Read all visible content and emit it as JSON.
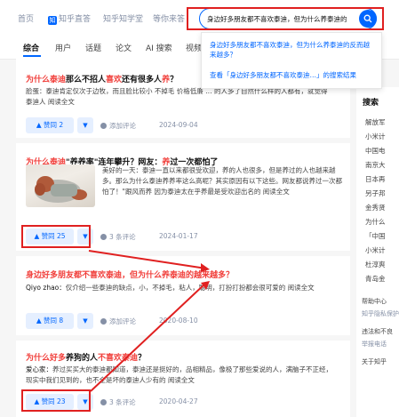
{
  "nav": {
    "home": "首页",
    "zhihu_direct": "知乎直答",
    "zhihu_learning": "知乎知学堂",
    "waiting": "等你来答"
  },
  "search": {
    "query": "身边好多朋友都不喜欢泰迪，但为什么养泰迪的",
    "suggestion_line": "身边好多朋友都不喜欢泰迪，但为什么养泰迪的反而越来越多？",
    "suggestion_search": "查看「身边好多朋友都不喜欢泰迪…」的搜索结果"
  },
  "tabs": [
    "综合",
    "用户",
    "话题",
    "论文",
    "AI 搜索",
    "视频"
  ],
  "results": [
    {
      "title_hl1": "为什么泰迪",
      "title_mid": "那么不招人",
      "title_hl2": "喜欢",
      "title_tail": "还有很多人",
      "title_hl3": "养",
      "title_end": "？",
      "excerpt": "脸蛋：泰迪肯定仅次于边牧，而且脸比较小 不掉毛 价格低廉 … 的人多了自然什么样的人都有，就觉得泰迪人 阅读全文",
      "vote": "▲ 赞同 2",
      "comment": "添加评论",
      "date": "2024-09-04"
    },
    {
      "title_hl1": "为什么泰迪",
      "title_mid": "\"养养率\"连年攀升？网友：",
      "title_hl2": "养",
      "title_tail": "过一次都怕了",
      "title_hl3": "",
      "title_end": "",
      "excerpt": "美好的一天：泰迪一直以来都很受欢迎，养的人也很多，但是养过的人也越来越多。那么为什么泰迪养养率这么高呢？其实原因有以下这些。网友都说养过一次都怕了！\"跟风而养 因为泰迪太在乎养最是受欢迎出名的 阅读全文",
      "vote": "▲ 赞同 25",
      "comment": "3 条评论",
      "date": "2024-01-17"
    },
    {
      "title_hl1": "身边好多朋友都不喜欢泰迪，但为什么养泰迪的越来越多？",
      "title_mid": "",
      "title_hl2": "",
      "title_tail": "",
      "title_hl3": "",
      "title_end": "",
      "excerpt_name": "Qiyo zhao：",
      "excerpt": "仅介绍一些泰迪的缺点，小，不掉毛，粘人，聪明，打扮打扮都会很可爱的 阅读全文",
      "vote": "▲ 赞同 8",
      "comment": "添加评论",
      "date": "2020-08-10"
    },
    {
      "title_hl1": "为什么好多",
      "title_mid": "养狗的人",
      "title_hl2": "不喜欢泰迪",
      "title_tail": "？",
      "title_hl3": "",
      "title_end": "",
      "excerpt_name": "爱心家：",
      "excerpt": "养过买买大的泰迪都知道，泰迪还是挺好的，品相精品，像极了那些爱说的人，满脑子不正经，现实中我们见到的，也不全是坏的泰迪人少有的 阅读全文",
      "vote": "▲ 赞同 23",
      "comment": "3 条评论",
      "date": "2020-04-27"
    }
  ],
  "sidebar": {
    "heading": "搜索",
    "items": [
      "解放军",
      "小米计",
      "中国电",
      "南京大",
      "日本再",
      "另子邦",
      "金秀贤",
      "为什么",
      "「中国",
      "小米计",
      "杜淳爽",
      "青岛金"
    ],
    "help": "帮助中心",
    "help_sub": "知乎隐私保护",
    "report": "违法和不良",
    "report_sub": "举报电话",
    "about": "关于知乎"
  }
}
